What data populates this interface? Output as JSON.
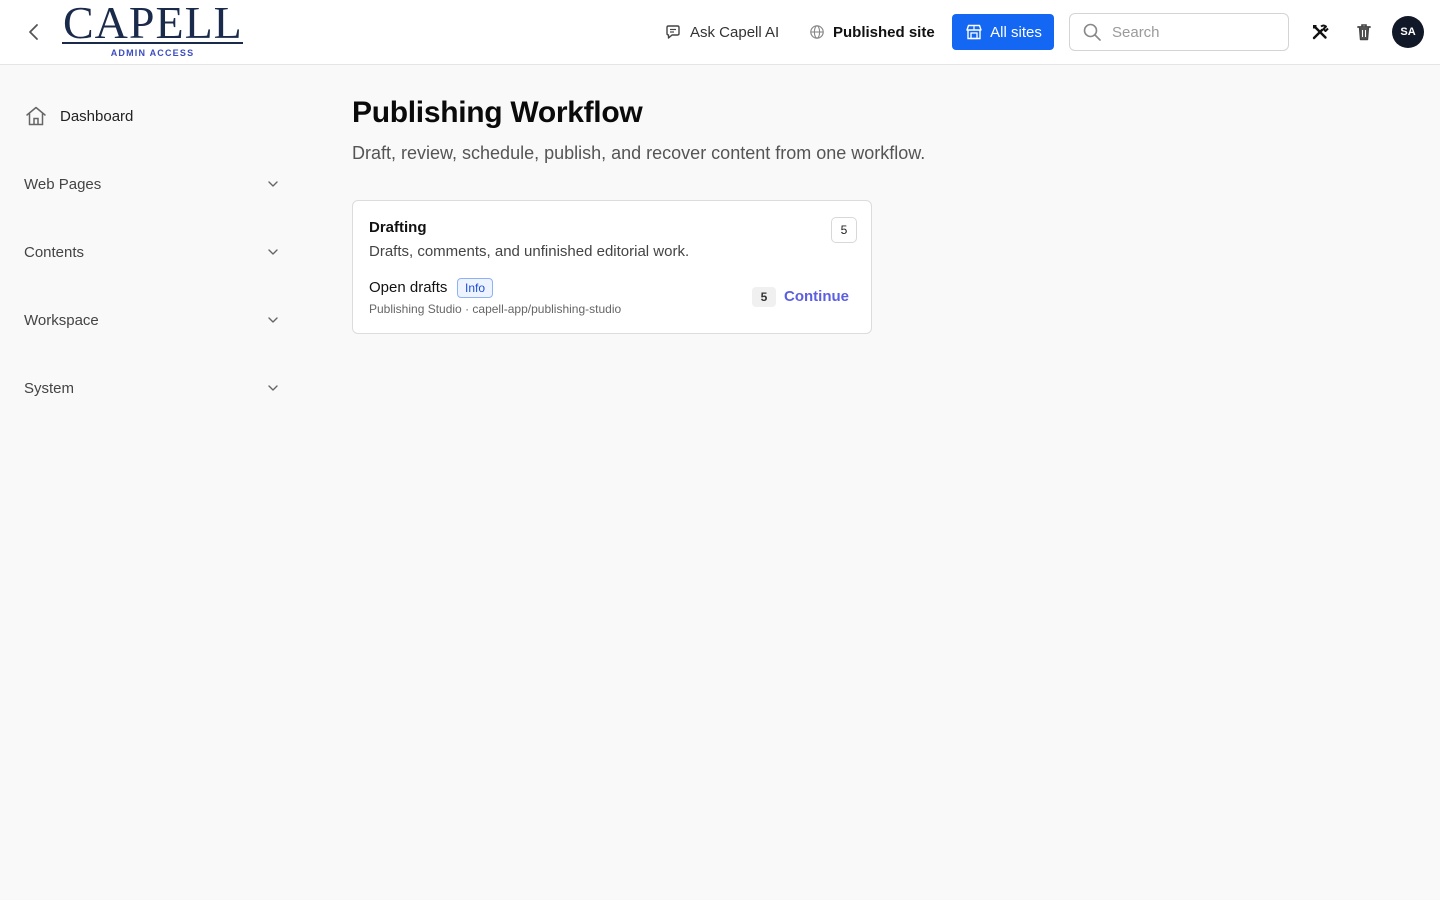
{
  "header": {
    "logo_text": "CAPELL",
    "logo_subtitle": "ADMIN ACCESS",
    "ask_ai_label": "Ask Capell AI",
    "published_site_label": "Published site",
    "all_sites_label": "All sites",
    "search_placeholder": "Search",
    "search_value": "",
    "avatar_initials": "SA",
    "accent_color": "#1467f2"
  },
  "sidebar": {
    "dashboard_label": "Dashboard",
    "groups": [
      {
        "label": "Web Pages",
        "icon": "chevron-down-icon"
      },
      {
        "label": "Contents",
        "icon": "chevron-down-icon"
      },
      {
        "label": "Workspace",
        "icon": "chevron-down-icon"
      },
      {
        "label": "System",
        "icon": "chevron-down-icon"
      }
    ]
  },
  "main": {
    "title": "Publishing Workflow",
    "subtitle": "Draft, review, schedule, publish, and recover content from one workflow.",
    "card": {
      "title": "Drafting",
      "description": "Drafts, comments, and unfinished editorial work.",
      "count": "5",
      "item": {
        "title": "Open drafts",
        "badge": "Info",
        "meta": "Publishing Studio · capell-app/publishing-studio",
        "count": "5",
        "action_label": "Continue"
      }
    }
  }
}
